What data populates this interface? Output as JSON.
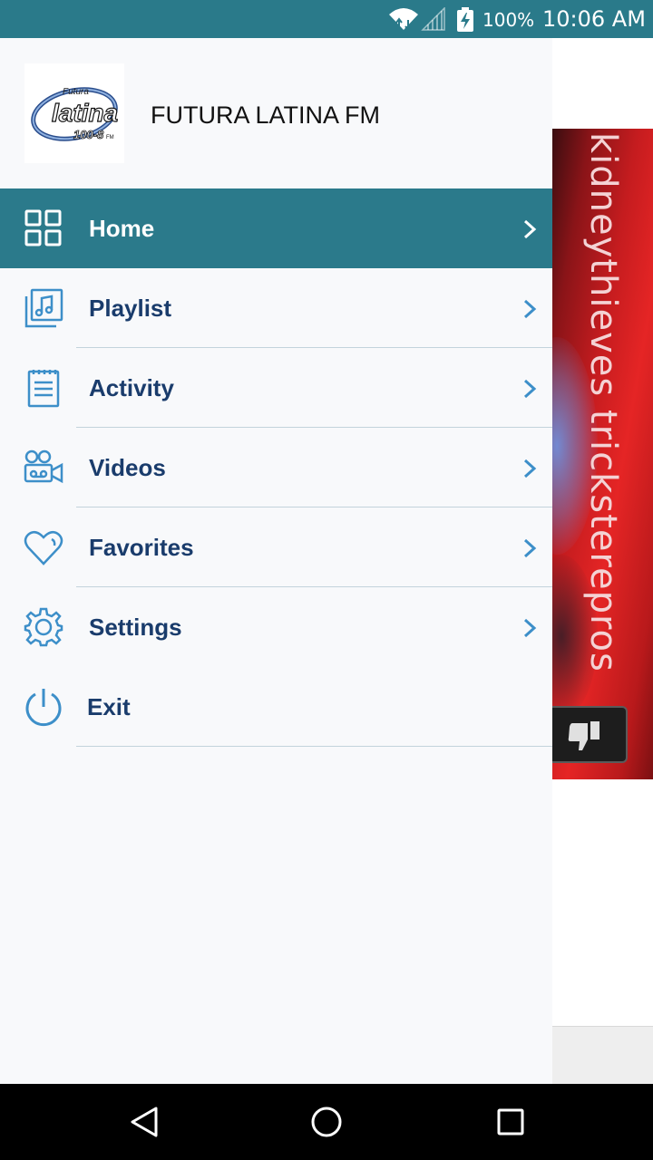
{
  "status_bar": {
    "battery_percent": "100%",
    "time": "10:06 AM",
    "icons": [
      "wifi-icon",
      "cell-signal-icon",
      "battery-charging-icon"
    ],
    "background_color": "#2a7a8a"
  },
  "drawer": {
    "app_title": "FUTURA LATINA FM",
    "logo": {
      "line1": "Futura",
      "line2": "latina",
      "line3": "100-8",
      "line3_suffix": "FM"
    },
    "accent_color": "#2b7a8b",
    "label_color": "#1a3c6c",
    "items": [
      {
        "label": "Home",
        "icon": "grid-icon",
        "active": true,
        "has_chevron": true
      },
      {
        "label": "Playlist",
        "icon": "music-note-icon",
        "active": false,
        "has_chevron": true
      },
      {
        "label": "Activity",
        "icon": "notepad-icon",
        "active": false,
        "has_chevron": true
      },
      {
        "label": "Videos",
        "icon": "video-camera-icon",
        "active": false,
        "has_chevron": true
      },
      {
        "label": "Favorites",
        "icon": "heart-icon",
        "active": false,
        "has_chevron": true
      },
      {
        "label": "Settings",
        "icon": "gear-icon",
        "active": false,
        "has_chevron": true
      },
      {
        "label": "Exit",
        "icon": "power-icon",
        "active": false,
        "has_chevron": false
      }
    ]
  },
  "background_ad": {
    "text": "kidneythieves tricksterepros",
    "dislike_icon": "thumbs-down-icon"
  },
  "nav_bar": {
    "buttons": [
      "back-icon",
      "home-circle-icon",
      "recents-icon"
    ]
  }
}
